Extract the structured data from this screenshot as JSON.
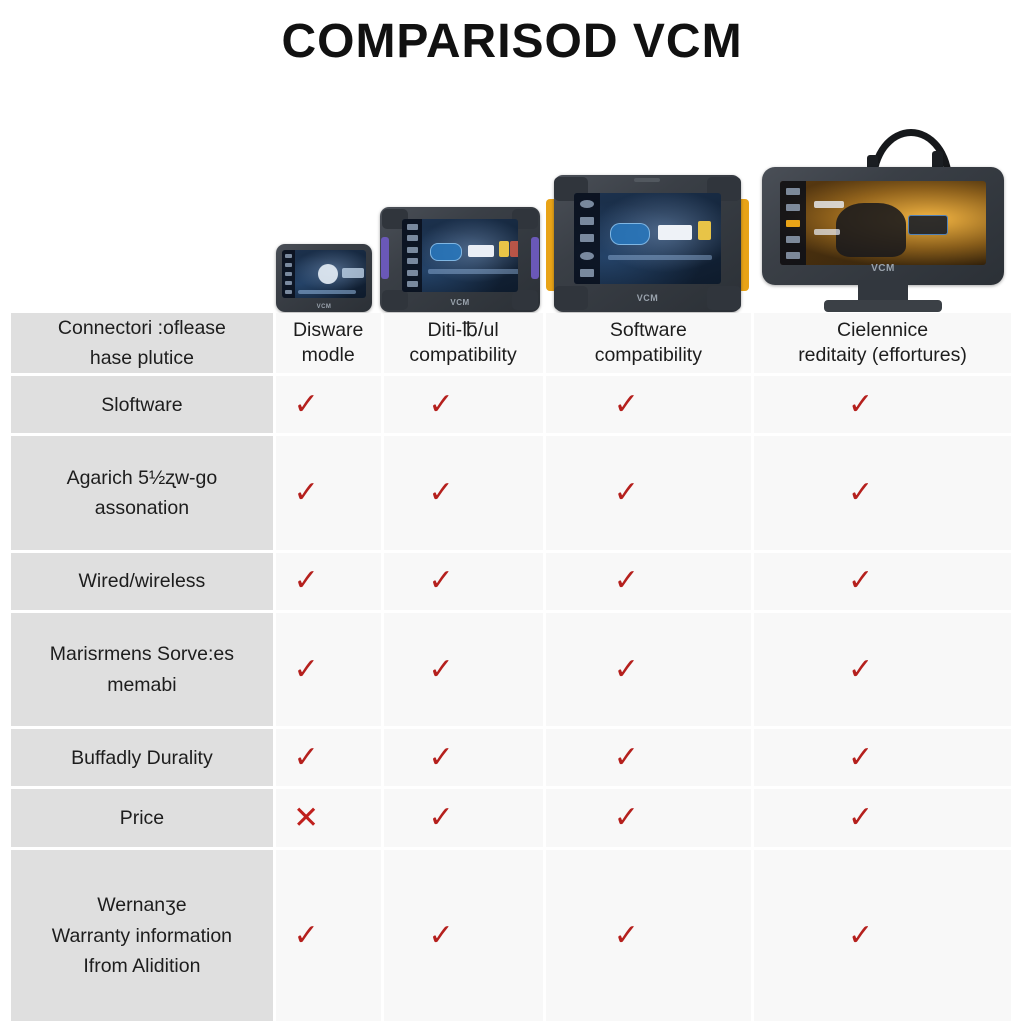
{
  "page": {
    "title": "COMPARISOD VCM",
    "background": "#ffffff"
  },
  "colors": {
    "tick": "#b5201d",
    "cross": "#c0201d",
    "row_label_bg": "#dfdfdf",
    "cell_bg": "#f8f8f8",
    "text": "#1d1d1d"
  },
  "devices": [
    {
      "name": "device-1-compact-scanner",
      "logo": "VCM",
      "screen_theme": "blue",
      "accent": "none"
    },
    {
      "name": "device-2-rugged-tablet",
      "logo": "VCM",
      "screen_theme": "blue",
      "accent": "#6a58b8"
    },
    {
      "name": "device-3-rugged-tablet-yellow",
      "logo": "VCM",
      "screen_theme": "blue",
      "accent": "#e8a317"
    },
    {
      "name": "device-4-large-display-with-cable",
      "logo": "VCM",
      "screen_theme": "amber",
      "accent": "none"
    }
  ],
  "table": {
    "corner_label": [
      "Connectori :oflease",
      "hase plutice"
    ],
    "columns": [
      {
        "label": [
          "Disware",
          "modle"
        ]
      },
      {
        "label": [
          "Diti-℔/ul",
          "compatibility"
        ]
      },
      {
        "label": [
          "Software",
          "compatibility"
        ]
      },
      {
        "label": [
          "Cielennice",
          "reditaity (effortures)"
        ]
      }
    ],
    "rows": [
      {
        "label": [
          "Sloftware"
        ],
        "cells": [
          "tick",
          "tick",
          "tick",
          "tick"
        ]
      },
      {
        "label": [
          "Agarich 5½ʐw-ɡo",
          "assonation"
        ],
        "cells": [
          "tick",
          "tick",
          "tick",
          "tick"
        ]
      },
      {
        "label": [
          "Wired/wireless"
        ],
        "cells": [
          "tick",
          "tick",
          "tick",
          "tick"
        ]
      },
      {
        "label": [
          "Marisrmens Sorve:es",
          "memabi"
        ],
        "cells": [
          "tick",
          "tick",
          "tick",
          "tick"
        ]
      },
      {
        "label": [
          "Buffadly Durality"
        ],
        "cells": [
          "tick",
          "tick",
          "tick",
          "tick"
        ]
      },
      {
        "label": [
          "Price"
        ],
        "cells": [
          "cross",
          "tick",
          "tick",
          "tick"
        ]
      },
      {
        "label": [
          "Wernanʒe",
          "Warranty information",
          "Ifrom Alidition"
        ],
        "cells": [
          "tick",
          "tick",
          "tick",
          "tick"
        ]
      }
    ],
    "glyphs": {
      "tick": "✓",
      "cross": "✕"
    }
  }
}
